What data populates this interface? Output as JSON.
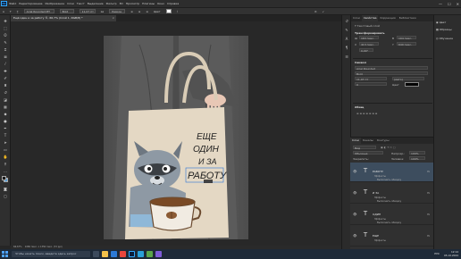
{
  "menubar": {
    "items": [
      "Файл",
      "Редактирование",
      "Изображение",
      "Слои",
      "Текст",
      "Выделение",
      "Фильтр",
      "3D",
      "Просмотр",
      "Плагины",
      "Окно",
      "Справка"
    ],
    "win_min": "—",
    "win_max": "☐",
    "win_close": "✕"
  },
  "options": {
    "text_orient": "T̲",
    "font_family": "Arial Rounded MT",
    "font_style": "Bold",
    "font_size": "11,07 пт",
    "aa_label": "aa",
    "aa_mode": "Резкое",
    "color_label": "Цвет",
    "commit": "✓",
    "cancel": "⊘"
  },
  "document": {
    "tab_title": "Ещё один и за работу ©, 66,7% (Слой 1, RGB/8) *",
    "tab_close": "×"
  },
  "artwork": {
    "text_line1": "ЕЩЕ",
    "text_line2": "ОДИН",
    "text_line3": "И ЗА",
    "text_line4": "РАБОТУ"
  },
  "status": {
    "zoom": "66,67%",
    "doc_size": "1080 пикс. x 1350 пикс. (72 ppi)"
  },
  "properties_panel": {
    "tabs": [
      "Слои",
      "Свойства",
      "Коррекция",
      "Библиотеки"
    ],
    "kind_label": "Текстовый слой",
    "transform_title": "Трансформировать",
    "w_label": "Ш",
    "w_value": "163 пикс.",
    "h_label": "В",
    "h_value": "194 пикс.",
    "x_label": "X",
    "x_value": "413 пикс.",
    "y_label": "Y",
    "y_value": "640 пикс.",
    "angle_value": "0,00°",
    "symbol_title": "Символ",
    "symbol_font": "Arial Rounded",
    "symbol_style": "Bold",
    "symbol_size": "11,07 пт",
    "symbol_leading": "(Авто)",
    "symbol_tracking": "0",
    "symbol_color_label": "Цвет",
    "paragraph_title": "Абзац"
  },
  "layers_panel": {
    "tabs": [
      "Слои",
      "Каналы",
      "Контуры"
    ],
    "search_placeholder": "Вид",
    "blend_mode": "Обычные",
    "opacity_label": "Непрозр.:",
    "opacity_value": "100%",
    "lock_label": "Закрепить:",
    "fill_label": "Заливка:",
    "fill_value": "100%",
    "rows": [
      {
        "name": "РАБОТУ",
        "effects_label": "Эффекты",
        "effect": "Выполнить обводку",
        "fx": "fx",
        "selected": true
      },
      {
        "name": "И ЗА",
        "effects_label": "Эффекты",
        "effect": "Выполнить обводку",
        "fx": "fx",
        "selected": false
      },
      {
        "name": "ОДИН",
        "effects_label": "Эффекты",
        "effect": "Выполнить обводку",
        "fx": "fx",
        "selected": false
      },
      {
        "name": "ЕЩЕ",
        "effects_label": "Эффекты",
        "effect": "Выполнить обводку",
        "fx": "fx",
        "selected": false
      }
    ]
  },
  "far_panel": {
    "items": [
      "Цвет",
      "Образцы",
      "Обучение"
    ]
  },
  "taskbar": {
    "search_placeholder": "Чтобы начать поиск, введите здесь запрос",
    "lang": "РУС",
    "time": "12:14",
    "date": "05.10.2024"
  },
  "colors": {
    "ps_blue": "#31a8ff",
    "bag": "#e4d8c4",
    "coat": "#5a5a5a",
    "raccoon": "#8e99a4",
    "cup": "#f1ebe2",
    "coffee": "#7a4a26"
  }
}
